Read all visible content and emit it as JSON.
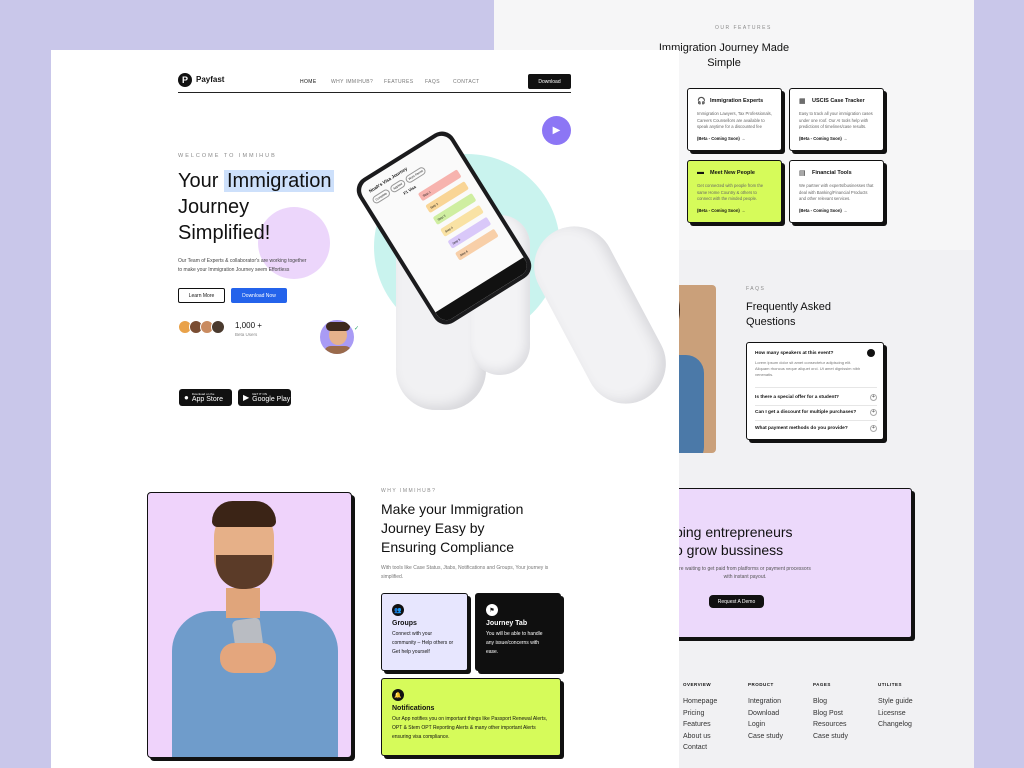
{
  "brand": "Payfast",
  "nav": [
    "HOME",
    "WHY IMMIHUB?",
    "FEATURES",
    "FAQS",
    "CONTACT"
  ],
  "nav_cta": "Download",
  "hero": {
    "eyebrow": "WELCOME TO IMMIHUB",
    "title_1": "Your",
    "title_highlight": "Immigration",
    "title_2": "Journey",
    "title_3": "Simplified!",
    "desc_1": "Our Team of Experts & collaborator's are working together",
    "desc_2": "to make your Immigration Journey seem Effortless",
    "btn_learn": "Learn More",
    "btn_download": "Download Now",
    "users_count": "1,000 +",
    "users_label": "Beta Users",
    "app_store_small": "Download on the",
    "app_store": "App Store",
    "play_small": "GET IT ON",
    "play": "Google Play"
  },
  "phone": {
    "title": "Noah's Visa Journey",
    "chips": [
      "Complete",
      "Applied",
      "Work Permit"
    ],
    "subtitle": "F1 Visa",
    "steps": [
      "Step 1",
      "Step 2",
      "Step 3",
      "Step 4",
      "Step 5",
      "Step 6"
    ]
  },
  "why": {
    "eyebrow": "WHY IMMIHUB?",
    "title_1": "Make your Immigration",
    "title_2": "Journey Easy by",
    "title_3": "Ensuring Compliance",
    "desc_1": "With tools like Case Status, Jtabs, Notifications and Groups, Your journey is",
    "desc_2": "simplified.",
    "cards": [
      {
        "title": "Groups",
        "desc": "Connect with your community – Help others or Get help yourself"
      },
      {
        "title": "Journey Tab",
        "desc": "You will be able to handle any issue/concerns with ease."
      },
      {
        "title": "Notifications",
        "desc": "Our App notifies you on important things like Passport Renewal Alerts, OPT & Stem OPT Reporting Alerts & many other important Alerts ensuring visa compliance."
      }
    ]
  },
  "features": {
    "eyebrow": "OUR FEATURES",
    "title_1": "Immigration Journey Made",
    "title_2": "Simple",
    "cards": [
      {
        "title": "Immigration Experts",
        "desc": "Immigration Lawyers, Tax Professionals, Careers Counsellors are available to speak anytime for a discounted fee",
        "badge": "(Beta - Coming Soon)"
      },
      {
        "title": "USCIS Case Tracker",
        "desc": "Easy to track all your immigration cases under one roof. Our AI tools help with predictions of timelines/case results.",
        "badge": "(Beta - Coming Soon)"
      },
      {
        "title": "Meet New People",
        "desc": "Get connected with people from the same Home Country & others to connect with the minded people.",
        "badge": "(Beta - Coming Soon)"
      },
      {
        "title": "Financial Tools",
        "desc": "We partner with experts/businesses that deal with Banking/Financial Products and other relevant services.",
        "badge": "(Beta - Coming Soon)"
      }
    ]
  },
  "faq": {
    "eyebrow": "FAQS",
    "title_1": "Frequently Asked",
    "title_2": "Questions",
    "open_q": "How many speakers at this event?",
    "open_a": "Lorem ipsum dolor sit amet consectetur adipiscing elit. Aliquam rhoncus neque aliquet orci. Ut amet dignissim nibh venenatis.",
    "items": [
      "Is there a special offer for a student?",
      "Can I get a discount for multiple purchases?",
      "What payment methods do you provide?"
    ]
  },
  "cta": {
    "title_1": "ping entrepreneurs",
    "title_2": "o grow bussiness",
    "desc_1": "re waiting to get paid from platforms or payment processors",
    "desc_2": "with instant payout.",
    "button": "Request A Demo"
  },
  "footer": [
    {
      "heading": "OVERVIEW",
      "links": [
        "Homepage",
        "Pricing",
        "Features",
        "About us",
        "Contact"
      ]
    },
    {
      "heading": "PRODUCT",
      "links": [
        "Integration",
        "Download",
        "Login",
        "Case study"
      ]
    },
    {
      "heading": "PAGES",
      "links": [
        "Blog",
        "Blog Post",
        "Resources",
        "Case study"
      ]
    },
    {
      "heading": "UTILITES",
      "links": [
        "Style guide",
        "Licesnse",
        "Changelog"
      ]
    }
  ],
  "colors": {
    "accent_blue": "#2463eb",
    "lime": "#d6fb5a",
    "lavender": "#eadcfb",
    "teal": "#c9f3ee",
    "purple": "#8c76f5"
  }
}
